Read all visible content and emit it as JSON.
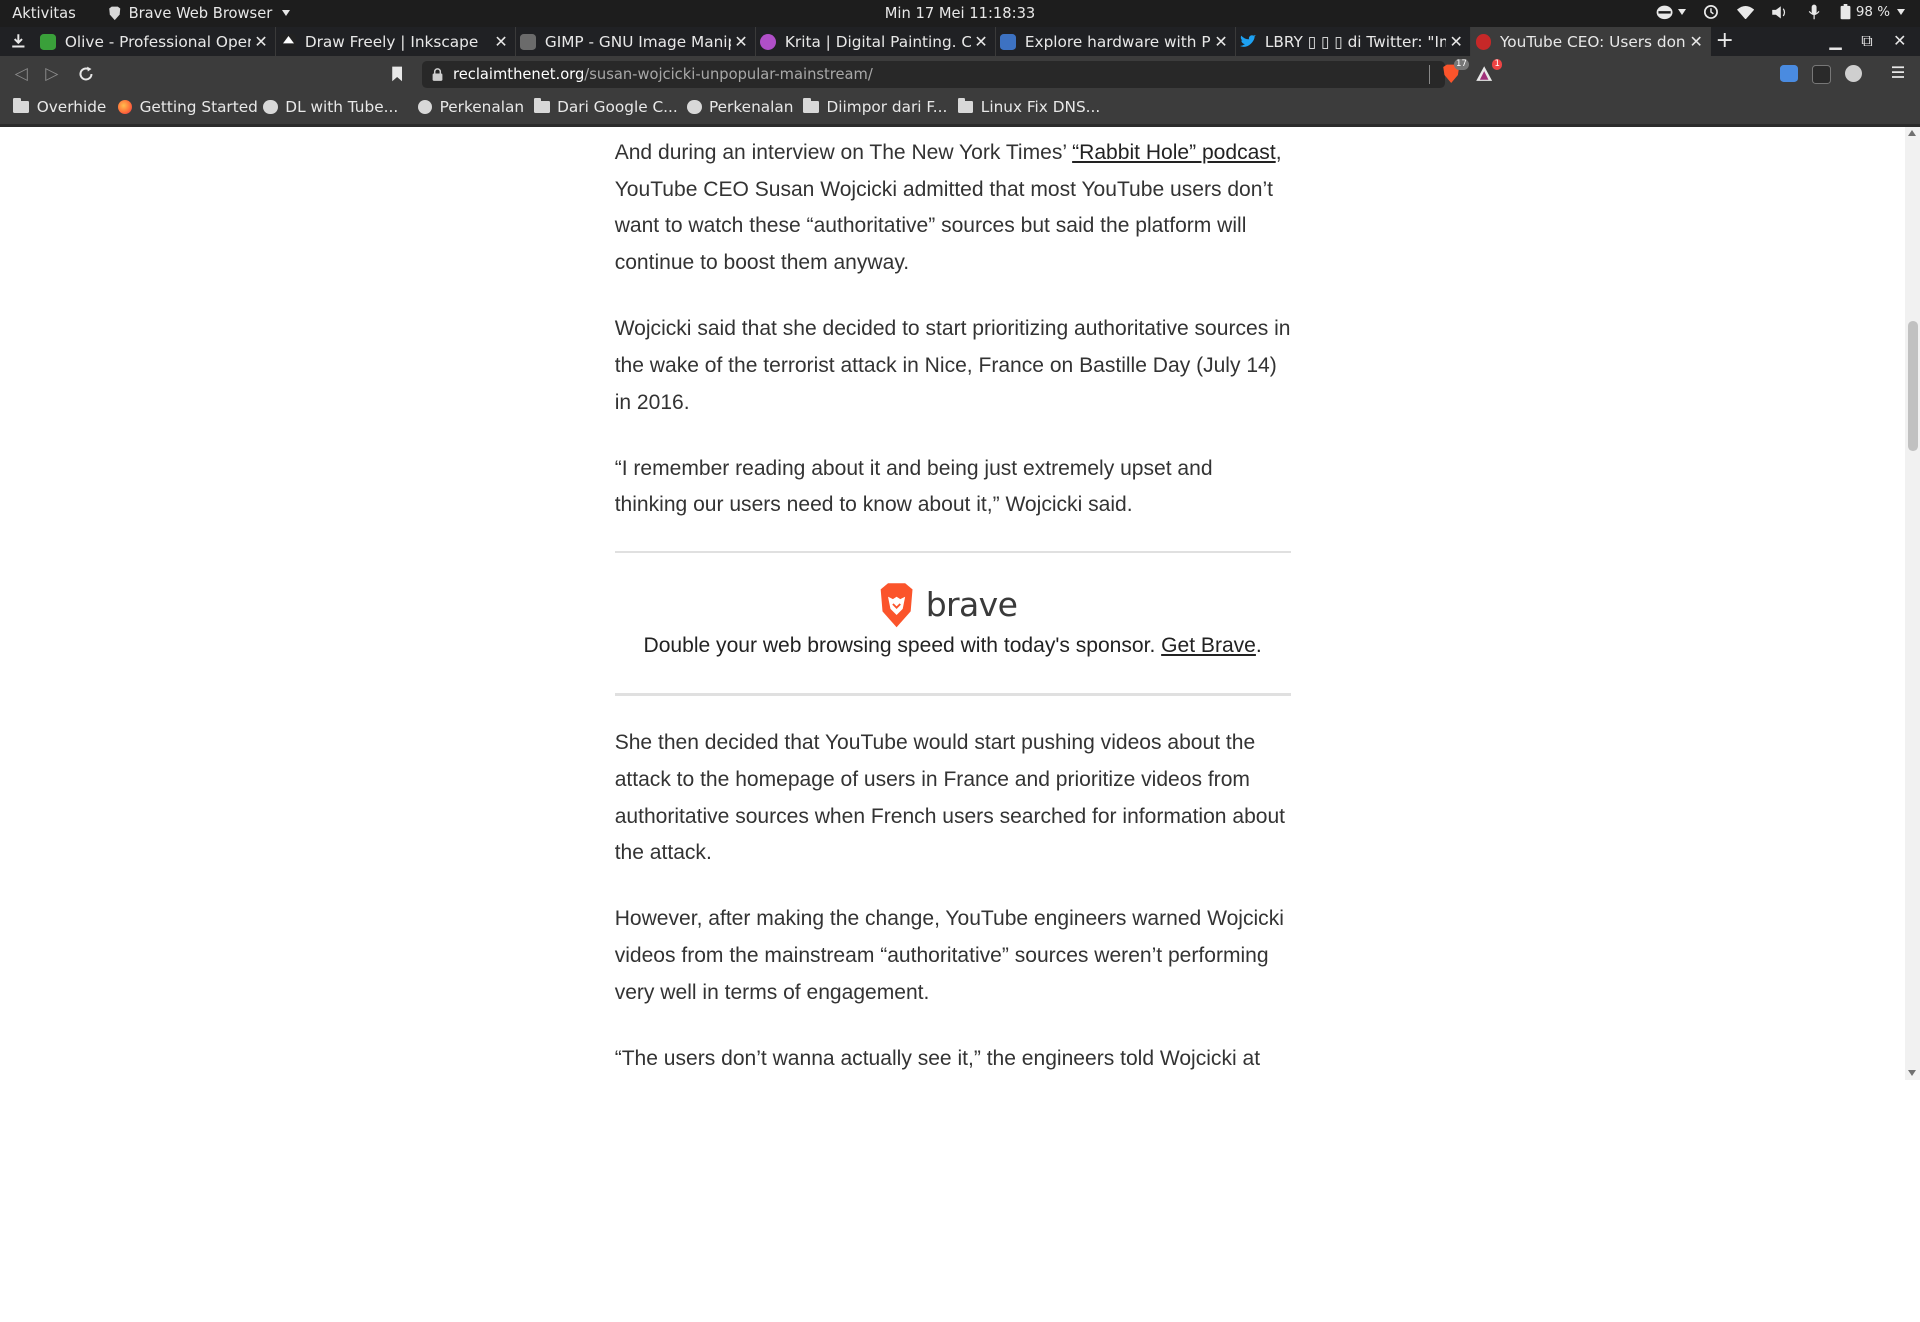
{
  "system_bar": {
    "activities": "Aktivitas",
    "app_name": "Brave Web Browser",
    "clock": "Min 17 Mei  11:18:33",
    "battery": "98 %"
  },
  "tabs": [
    {
      "title": "Olive - Professional Open-S",
      "favicon_color": "#3aa03a"
    },
    {
      "title": "Draw Freely | Inkscape",
      "favicon_color": "#222222"
    },
    {
      "title": "GIMP - GNU Image Manipul",
      "favicon_color": "#6b6b6b"
    },
    {
      "title": "Krita | Digital Painting. Cre",
      "favicon_color": "#b04fc8"
    },
    {
      "title": "Explore hardware with Pla",
      "favicon_color": "#3d72c2"
    },
    {
      "title": "LBRY ▯ ▯ ▯ di Twitter: \"Imag",
      "favicon_color": "#1da1f2"
    },
    {
      "title": "YouTube CEO: Users don't",
      "favicon_color": "#c62828",
      "active": true
    }
  ],
  "address": {
    "host": "reclaimthenet.org",
    "path": "/susan-wojcicki-unpopular-mainstream/",
    "shield_count": "17",
    "rewards_count": "1"
  },
  "bookmarks": [
    {
      "label": "Overhide",
      "icon": "folder-icon"
    },
    {
      "label": "Getting Started",
      "icon": "firefox-icon"
    },
    {
      "label": "DL with Tube...",
      "icon": "globe-icon"
    },
    {
      "label": "Perkenalan",
      "icon": "globe-icon"
    },
    {
      "label": "Dari Google C...",
      "icon": "folder-icon"
    },
    {
      "label": "Perkenalan",
      "icon": "globe-icon"
    },
    {
      "label": "Diimpor dari F...",
      "icon": "folder-icon"
    },
    {
      "label": "Linux Fix DNS...",
      "icon": "folder-icon"
    }
  ],
  "article": {
    "p1_before": "And during an interview on The New York Times’ ",
    "p1_link": "“Rabbit Hole” podcast",
    "p1_after": ", YouTube CEO Susan Wojcicki admitted that most YouTube users don’t want to watch these “authoritative” sources but said the platform will continue to boost them anyway.",
    "p2": "Wojcicki said that she decided to start prioritizing authoritative sources in the wake of the terrorist attack in Nice, France on Bastille Day (July 14) in 2016.",
    "p3": "“I remember reading about it and being just extremely upset and thinking our users need to know about it,” Wojcicki said.",
    "p4": "She then decided that YouTube would start pushing videos about the attack to the homepage of users in France and prioritize videos from authoritative sources when French users searched for information about the attack.",
    "p5": "However, after making the change, YouTube engineers warned Wojcicki videos from the mainstream “authoritative” sources weren’t performing very well in terms of engagement.",
    "p6": "“The users don’t wanna actually see it,” the engineers told Wojcicki at the"
  },
  "sponsor": {
    "brand": "brave",
    "text_before": "Double your web browsing speed with today's sponsor. ",
    "link": "Get Brave",
    "text_after": "."
  }
}
